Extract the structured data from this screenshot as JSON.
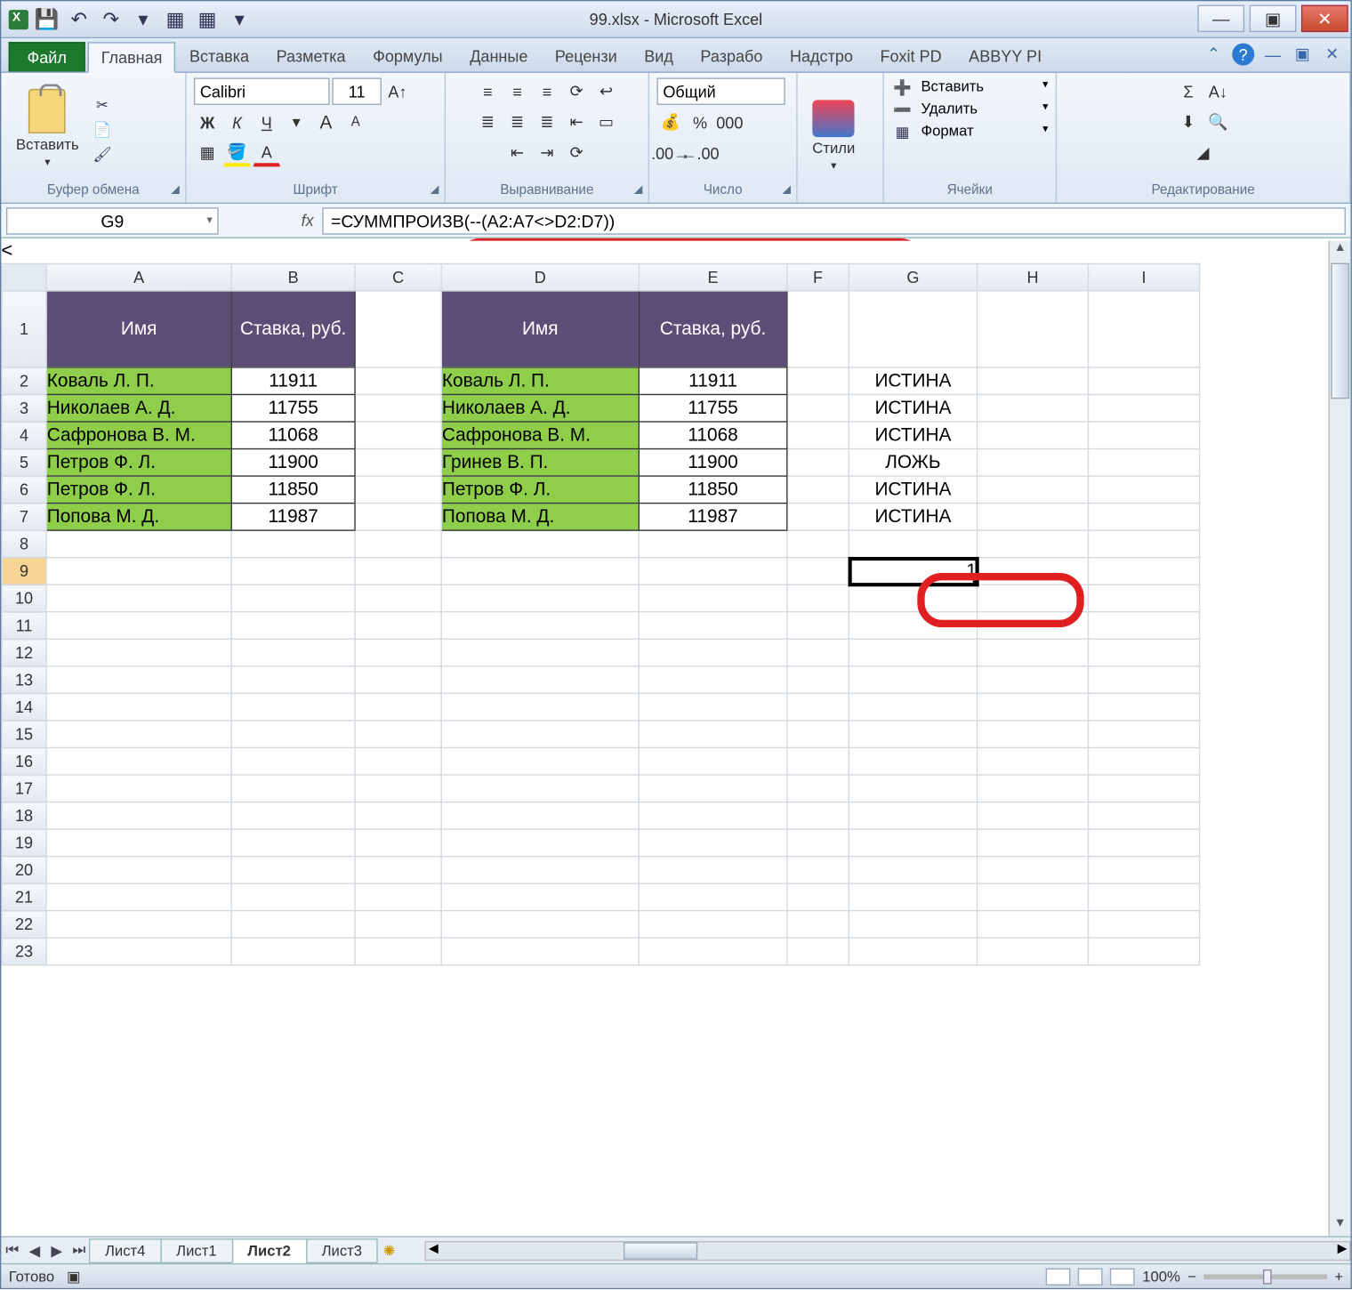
{
  "window": {
    "title": "99.xlsx - Microsoft Excel"
  },
  "qat": {
    "save": "💾",
    "undo": "↶",
    "redo": "↷"
  },
  "tabs": {
    "file": "Файл",
    "items": [
      "Главная",
      "Вставка",
      "Разметка",
      "Формулы",
      "Данные",
      "Рецензи",
      "Вид",
      "Разрабо",
      "Надстро",
      "Foxit PD",
      "ABBYY PI"
    ],
    "active_index": 0
  },
  "ribbon": {
    "clipboard": {
      "label": "Буфер обмена",
      "paste": "Вставить"
    },
    "font": {
      "label": "Шрифт",
      "name": "Calibri",
      "size": "11"
    },
    "alignment": {
      "label": "Выравнивание"
    },
    "number": {
      "label": "Число",
      "format": "Общий"
    },
    "styles": {
      "label": "Стили",
      "btn": "Стили"
    },
    "cells": {
      "label": "Ячейки",
      "insert": "Вставить",
      "delete": "Удалить",
      "format": "Формат"
    },
    "editing": {
      "label": "Редактирование"
    }
  },
  "formula_bar": {
    "name_box": "G9",
    "fx": "fx",
    "formula": "=СУММПРОИЗВ(--(A2:A7<>D2:D7))"
  },
  "columns": [
    "A",
    "B",
    "C",
    "D",
    "E",
    "F",
    "G",
    "H",
    "I"
  ],
  "rows": [
    "1",
    "2",
    "3",
    "4",
    "5",
    "6",
    "7",
    "8",
    "9",
    "10",
    "11",
    "12",
    "13",
    "14",
    "15",
    "16",
    "17",
    "18",
    "19",
    "20",
    "21",
    "22",
    "23"
  ],
  "headers": {
    "A1": "Имя",
    "B1": "Ставка, руб.",
    "D1": "Имя",
    "E1": "Ставка, руб."
  },
  "table1": [
    {
      "name": "Коваль Л. П.",
      "rate": "11911"
    },
    {
      "name": "Николаев А. Д.",
      "rate": "11755"
    },
    {
      "name": "Сафронова В. М.",
      "rate": "11068"
    },
    {
      "name": "Петров Ф. Л.",
      "rate": "11900"
    },
    {
      "name": "Петров Ф. Л.",
      "rate": "11850"
    },
    {
      "name": "Попова М. Д.",
      "rate": "11987"
    }
  ],
  "table2": [
    {
      "name": "Коваль Л. П.",
      "rate": "11911"
    },
    {
      "name": "Николаев А. Д.",
      "rate": "11755"
    },
    {
      "name": "Сафронова В. М.",
      "rate": "11068"
    },
    {
      "name": "Гринев В. П.",
      "rate": "11900"
    },
    {
      "name": "Петров Ф. Л.",
      "rate": "11850"
    },
    {
      "name": "Попова М. Д.",
      "rate": "11987"
    }
  ],
  "colG": [
    "ИСТИНА",
    "ИСТИНА",
    "ИСТИНА",
    "ЛОЖЬ",
    "ИСТИНА",
    "ИСТИНА"
  ],
  "g9": "1",
  "sheet_tabs": {
    "items": [
      "Лист4",
      "Лист1",
      "Лист2",
      "Лист3"
    ],
    "active_index": 2
  },
  "status": {
    "ready": "Готово",
    "zoom": "100%"
  }
}
